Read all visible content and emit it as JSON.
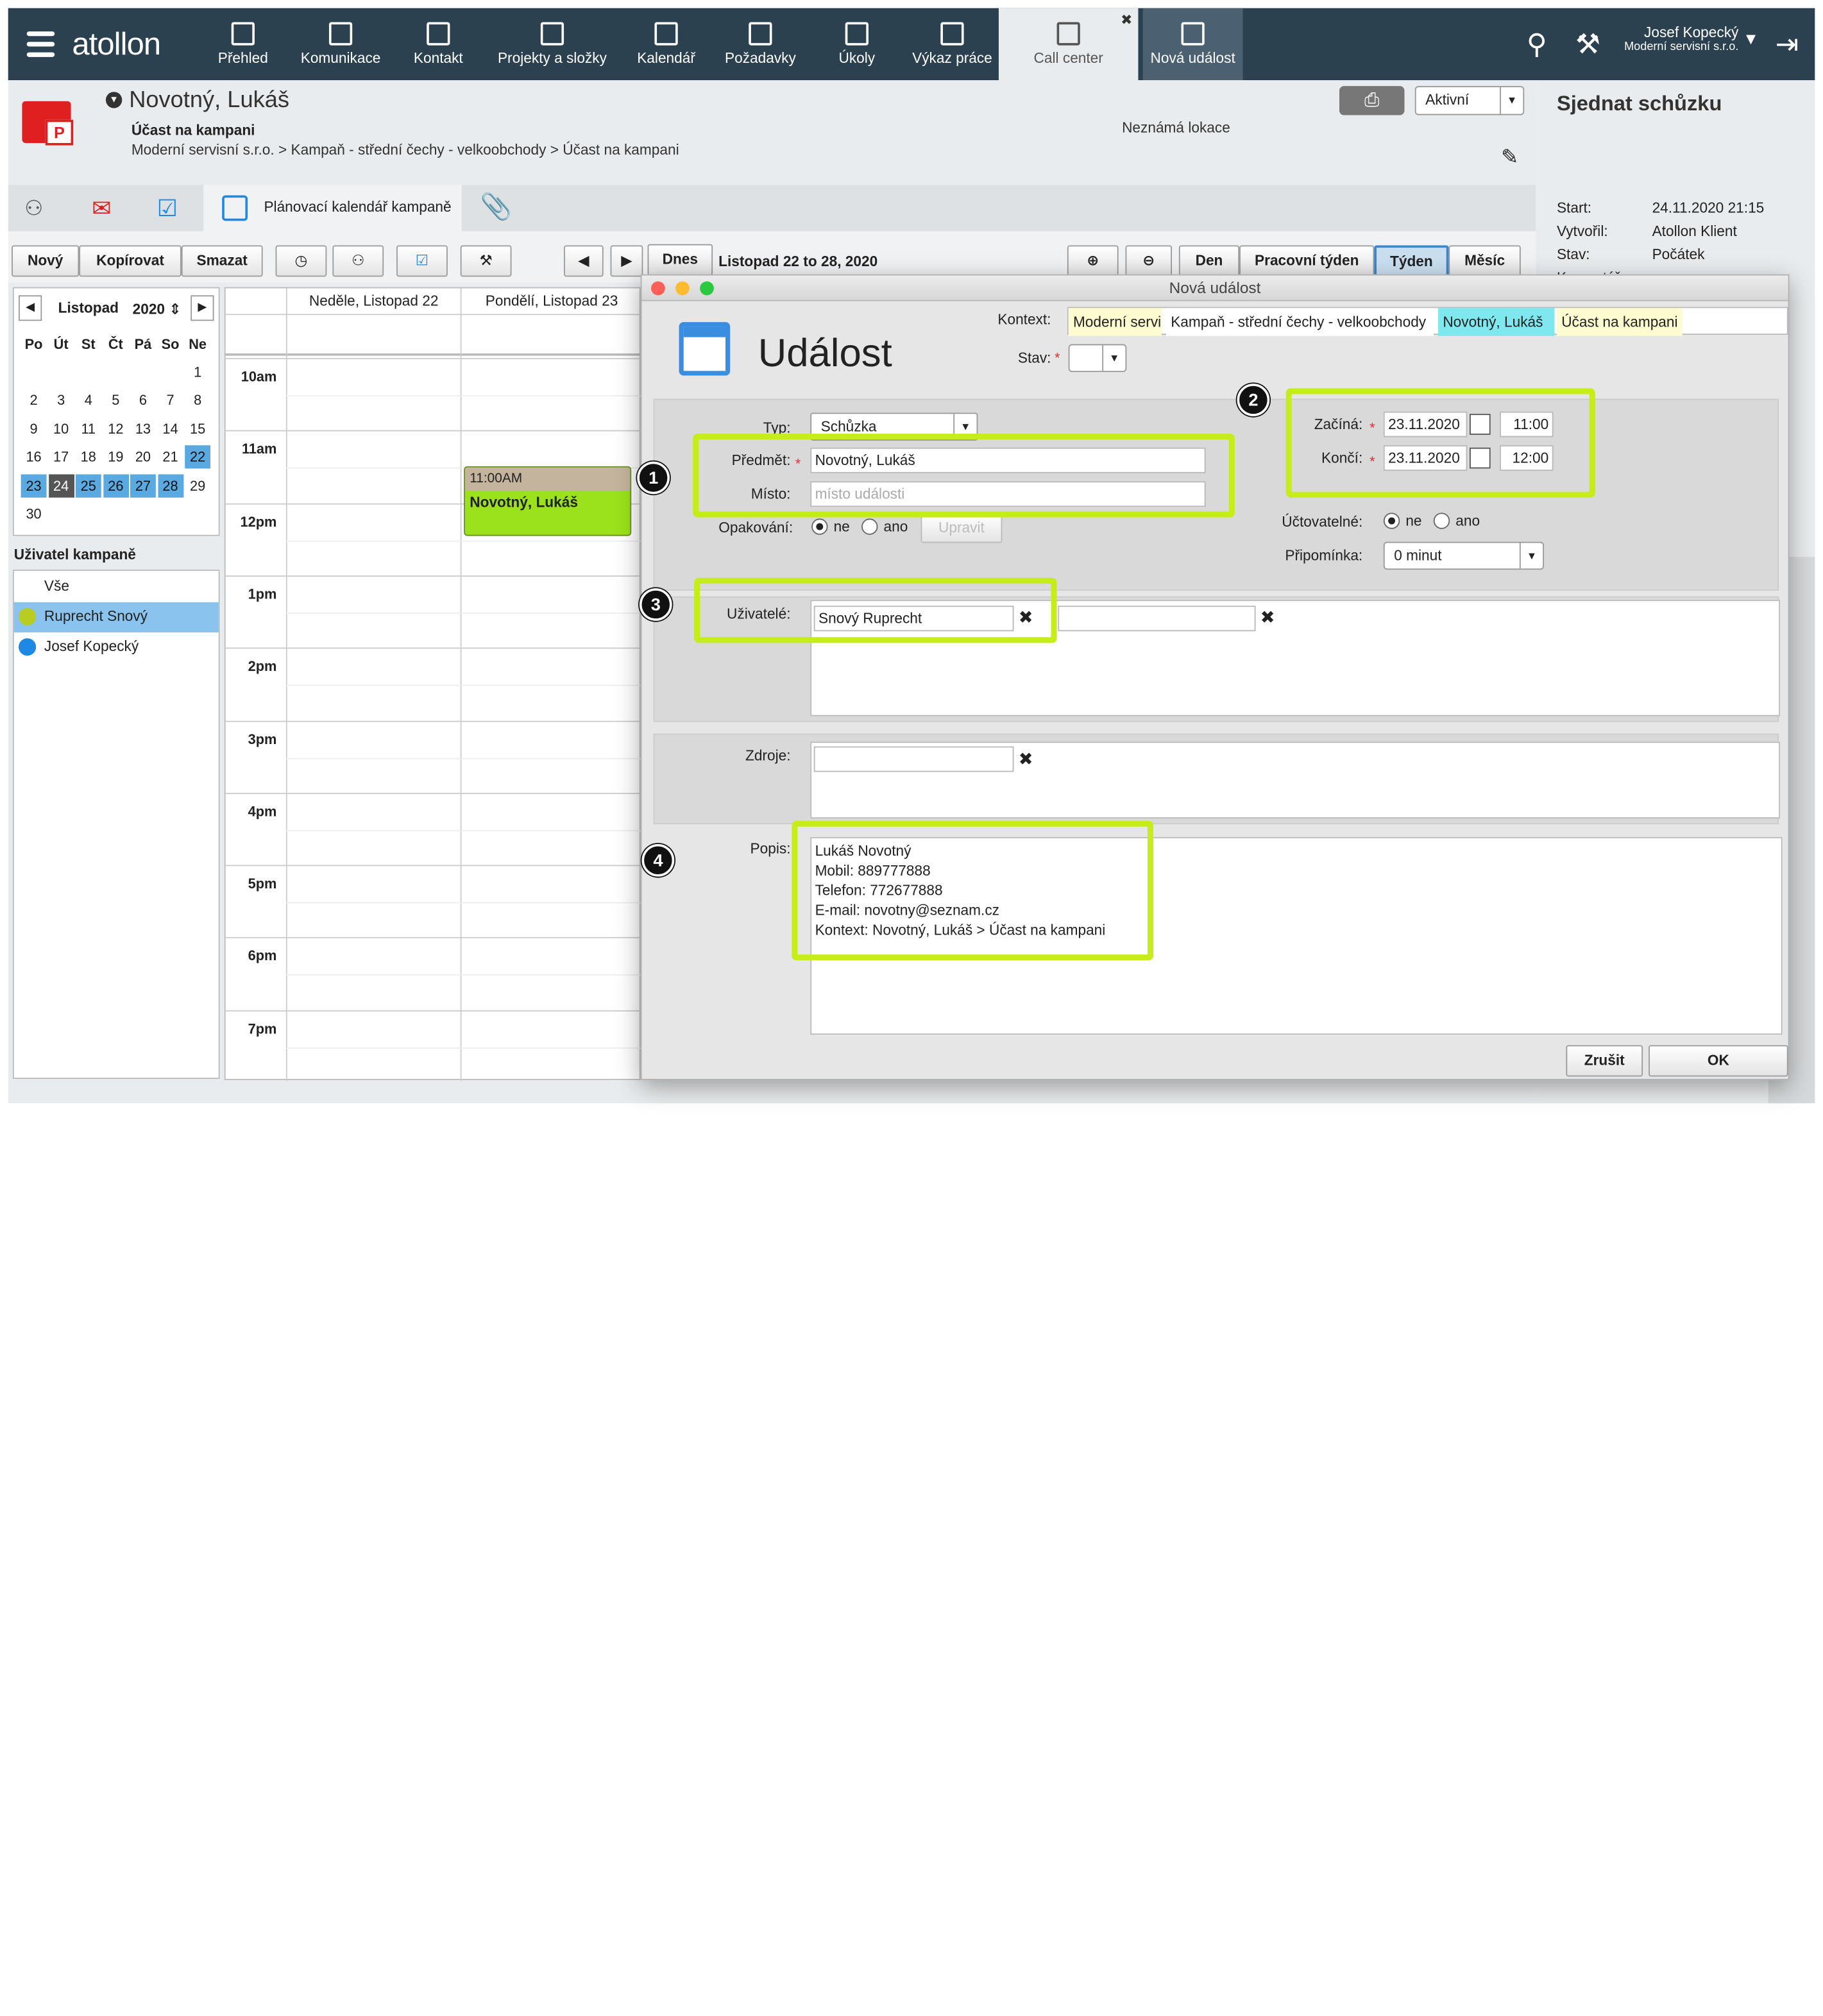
{
  "nav": {
    "logo": "atollon",
    "items": [
      "Přehled",
      "Komunikace",
      "Kontakt",
      "Projekty a složky",
      "Kalendář",
      "Požadavky",
      "Úkoly",
      "Výkaz práce",
      "Call center",
      "Nová událost"
    ],
    "user_name": "Josef Kopecký",
    "user_company": "Moderní servisní s.r.o."
  },
  "header": {
    "name": "Novotný, Lukáš",
    "subtitle": "Účast na kampani",
    "path": "Moderní servisní s.r.o. > Kampaň - střední čechy - velkoobchody > Účast na kampani",
    "location": "Neznámá lokace",
    "status": "Aktivní"
  },
  "rightpanel": {
    "title": "Sjednat schůzku",
    "rows": [
      {
        "k": "Start:",
        "v": "24.11.2020 21:15"
      },
      {
        "k": "Vytvořil:",
        "v": "Atollon Klient"
      },
      {
        "k": "Stav:",
        "v": "Počátek"
      }
    ],
    "cut": "Komentáře:"
  },
  "tabs": {
    "planning": "Plánovací kalendář kampaně"
  },
  "toolbar": {
    "new": "Nový",
    "copy": "Kopírovat",
    "delete": "Smazat",
    "today": "Dnes",
    "range": "Listopad 22 to 28, 2020",
    "day": "Den",
    "workweek": "Pracovní týden",
    "week": "Týden",
    "month": "Měsíc"
  },
  "minical": {
    "month": "Listopad",
    "year": "2020",
    "weekdays": [
      "Po",
      "Út",
      "St",
      "Čt",
      "Pá",
      "So",
      "Ne"
    ],
    "days": [
      [
        "",
        "",
        "",
        "",
        "",
        "",
        "1"
      ],
      [
        "2",
        "3",
        "4",
        "5",
        "6",
        "7",
        "8"
      ],
      [
        "9",
        "10",
        "11",
        "12",
        "13",
        "14",
        "15"
      ],
      [
        "16",
        "17",
        "18",
        "19",
        "20",
        "21",
        "22"
      ],
      [
        "23",
        "24",
        "25",
        "26",
        "27",
        "28",
        "29"
      ],
      [
        "30",
        "",
        "",
        "",
        "",
        "",
        ""
      ]
    ]
  },
  "users": {
    "title": "Uživatel kampaně",
    "all": "Vše",
    "list": [
      {
        "name": "Ruprecht Snový",
        "color": "#b8cc22"
      },
      {
        "name": "Josef Kopecký",
        "color": "#1e88e5"
      }
    ]
  },
  "calendar": {
    "col1": "Neděle, Listopad 22",
    "col2": "Pondělí, Listopad 23",
    "hours": [
      "10am",
      "11am",
      "12pm",
      "1pm",
      "2pm",
      "3pm",
      "4pm",
      "5pm",
      "6pm",
      "7pm"
    ],
    "event_time": "11:00AM",
    "event_title": "Novotný, Lukáš"
  },
  "dialog": {
    "title": "Nová událost",
    "heading": "Událost",
    "kontext_label": "Kontext:",
    "kontext": [
      "Moderní servisní s.r.o.",
      "Kampaň - střední čechy - velkoobchody",
      "Novotný, Lukáš",
      "Účast na kampani"
    ],
    "stav_label": "Stav:",
    "typ_label": "Typ:",
    "typ": "Schůzka",
    "predmet_label": "Předmět:",
    "predmet": "Novotný, Lukáš",
    "misto_label": "Místo:",
    "misto_ph": "místo události",
    "opak_label": "Opakování:",
    "ne": "ne",
    "ano": "ano",
    "upravit": "Upravit",
    "zacina_label": "Začíná:",
    "zacina_date": "23.11.2020",
    "zacina_time": "11:00",
    "konci_label": "Končí:",
    "konci_date": "23.11.2020",
    "konci_time": "12:00",
    "uct_label": "Účtovatelné:",
    "pripom_label": "Připomínka:",
    "pripom": "0 minut",
    "uziv_label": "Uživatelé:",
    "uziv": "Snový  Ruprecht",
    "zdroje_label": "Zdroje:",
    "popis_label": "Popis:",
    "popis": [
      "Lukáš Novotný",
      "Mobil: 889777888",
      "Telefon: 772677888",
      "E-mail: novotny@seznam.cz",
      "Kontext: Novotný, Lukáš > Účast na kampani"
    ],
    "cancel": "Zrušit",
    "ok": "OK"
  },
  "markers": [
    "1",
    "2",
    "3",
    "4"
  ],
  "colors": {
    "nav": "#2b4150",
    "highlight": "#c6ec1a",
    "event": "#9be21c",
    "crumb_yellow": "#fdfbd0",
    "crumb_cyan": "#7fe7ee"
  }
}
